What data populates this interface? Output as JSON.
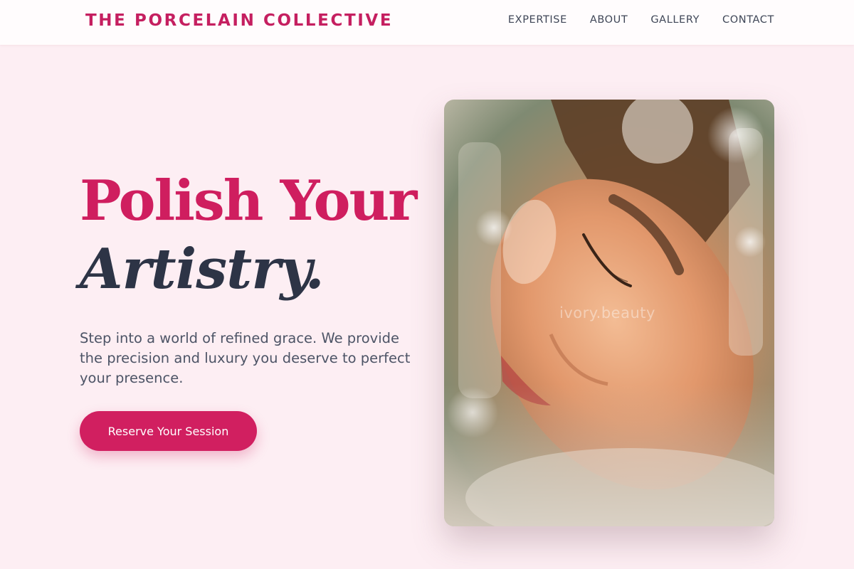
{
  "nav": {
    "brand": "THE PORCELAIN COLLECTIVE",
    "links": [
      {
        "label": "EXPERTISE"
      },
      {
        "label": "ABOUT"
      },
      {
        "label": "GALLERY"
      },
      {
        "label": "CONTACT"
      }
    ]
  },
  "hero": {
    "title_line1": "Polish Your",
    "title_line2": "Artistry.",
    "description": "Step into a world of refined grace. We provide the precision and luxury you deserve to perfect your presence.",
    "cta_label": "Reserve Your Session",
    "image_watermark": "ivory.beauty"
  },
  "colors": {
    "brand": "#c51f60",
    "accent": "#d11f60",
    "background": "#fdeef3",
    "heading_dark": "#2d3446",
    "body_text": "#4d5466"
  }
}
